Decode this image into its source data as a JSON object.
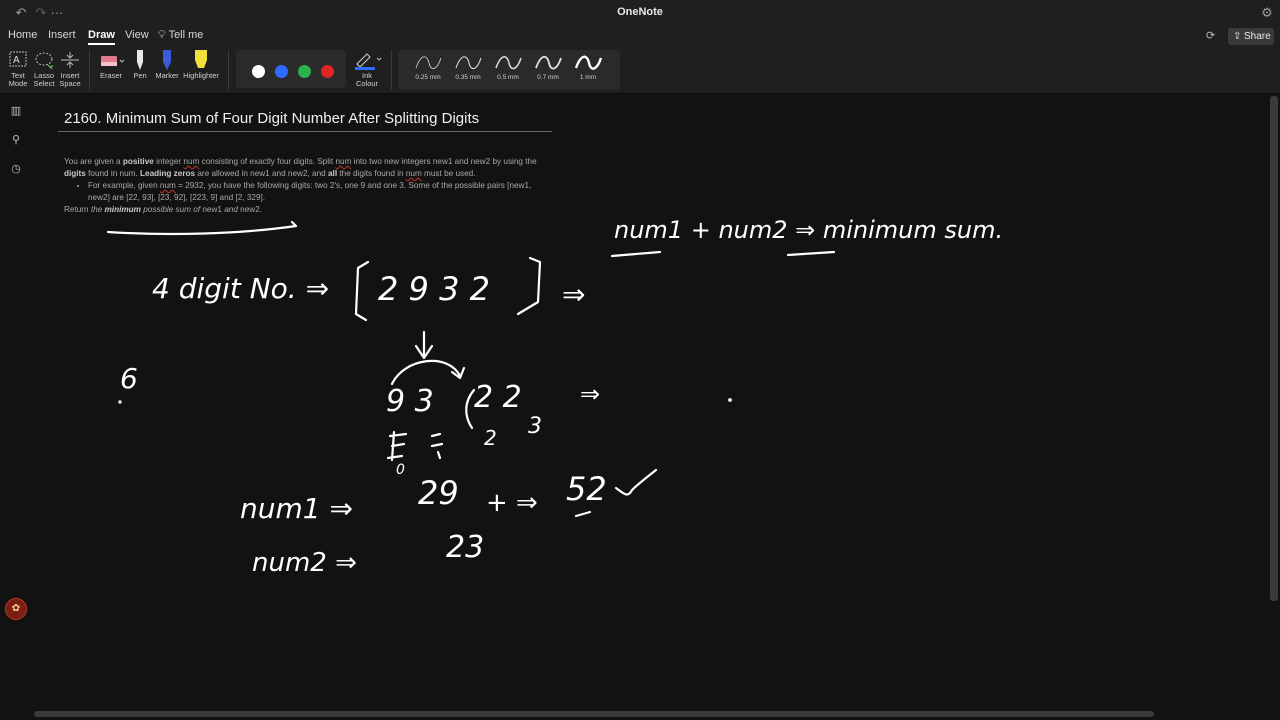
{
  "titlebar": {
    "app_title": "OneNote"
  },
  "tabs": [
    {
      "label": "Home"
    },
    {
      "label": "Insert"
    },
    {
      "label": "Draw"
    },
    {
      "label": "View"
    },
    {
      "label": "Tell me"
    }
  ],
  "share_label": "Share",
  "ribbon": {
    "tools": [
      {
        "label": "Text\nMode"
      },
      {
        "label": "Lasso\nSelect"
      },
      {
        "label": "Insert\nSpace"
      },
      {
        "label": "Eraser"
      },
      {
        "label": "Pen"
      },
      {
        "label": "Marker"
      },
      {
        "label": "Highlighter"
      }
    ],
    "ink_colour_label": "Ink\nColour",
    "colors": [
      "#ffffff",
      "#2f6bff",
      "#2bb24c",
      "#e02424"
    ],
    "strokes": [
      "0.25 mm",
      "0.35 mm",
      "0.5 mm",
      "0.7 mm",
      "1 mm"
    ]
  },
  "page": {
    "title": "2160. Minimum Sum of Four Digit Number After Splitting Digits",
    "p1_a": "You are given a ",
    "p1_b": "positive",
    "p1_c": " integer ",
    "p1_d": "num",
    "p1_e": " consisting of exactly four digits. Split ",
    "p1_f": "num",
    "p1_g": " into two new integers new1 and new2 by using the ",
    "p1_h": "digits",
    "p1_i": " found in num. ",
    "p1_j": "Leading zeros",
    "p1_k": " are allowed in new1 and new2, and ",
    "p1_l": "all",
    "p1_m": " the digits found in ",
    "p1_n": "num",
    "p1_o": " must be used.",
    "li_a": "For example, given ",
    "li_b": "num",
    "li_c": " = 2932, you have the following digits: two 2's, one 9 and one 3. Some of the possible pairs [new1, new2] are [22, 93], [23, 92], [223, 9] and [2, 329].",
    "ret_a": "Return ",
    "ret_b": "the ",
    "ret_c": "minimum",
    "ret_d": " possible sum of ",
    "ret_e": "new1",
    "ret_f": " and ",
    "ret_g": "new2",
    "ret_h": "."
  },
  "ink": {
    "eq_top": "num1  +  num2  ⇒  minimum sum.",
    "four_digit": "4 digit  No.  ⇒",
    "num_digits": "2 9 3 2",
    "arrow_after": "⇒",
    "six": "6",
    "sorted_a": "9  3",
    "sorted_b": "2  2",
    "arrow_mid": "⇒",
    "index_a": "2",
    "index_b": "3",
    "zero": "0",
    "num1_label": "num1  ⇒",
    "num1_val": "29",
    "plus_arrow": "+  ⇒",
    "sum_val": "52",
    "num2_label": "num2   ⇒",
    "num2_val": "23"
  }
}
